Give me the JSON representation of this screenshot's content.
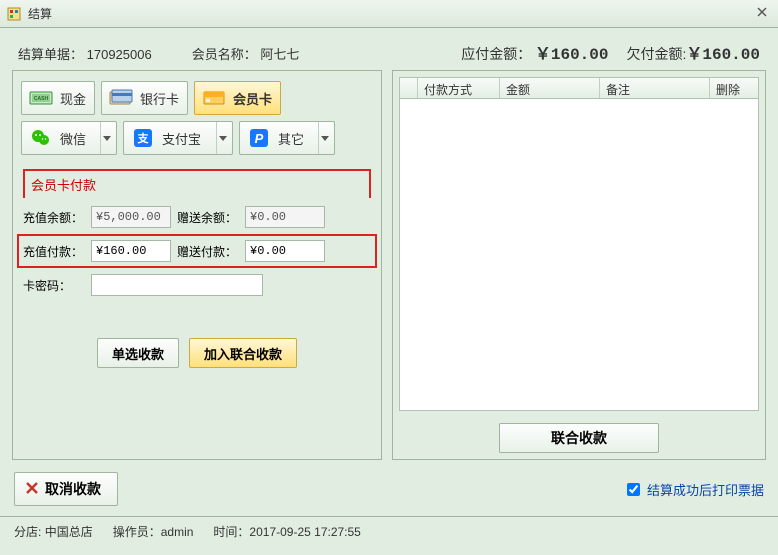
{
  "window": {
    "title": "结算"
  },
  "info": {
    "order_label": "结算单据：",
    "order_no": "170925006",
    "member_label": "会员名称：",
    "member_name": "阿七七",
    "due_label": "应付金额：",
    "due_value": "￥160.00",
    "owed_label": "欠付金额:",
    "owed_value": "￥160.00"
  },
  "pay_methods": {
    "cash": "现金",
    "bank": "银行卡",
    "member": "会员卡",
    "wechat": "微信",
    "alipay": "支付宝",
    "other": "其它"
  },
  "section": {
    "title": "会员卡付款",
    "recharge_balance_label": "充值余额：",
    "recharge_balance": "¥5,000.00",
    "gift_balance_label": "赠送余额：",
    "gift_balance": "¥0.00",
    "recharge_pay_label": "充值付款：",
    "recharge_pay": "¥160.00",
    "gift_pay_label": "赠送付款：",
    "gift_pay": "¥0.00",
    "card_pwd_label": "卡密码："
  },
  "buttons": {
    "single": "单选收款",
    "join": "加入联合收款",
    "combine": "联合收款",
    "cancel": "取消收款"
  },
  "grid": {
    "col_method": "付款方式",
    "col_amount": "金额",
    "col_remark": "备注",
    "col_delete": "删除"
  },
  "checkbox": {
    "print_label": "结算成功后打印票据"
  },
  "status": {
    "branch_label": "分店:",
    "branch": "中国总店",
    "op_label": "操作员：",
    "op": "admin",
    "time_label": "时间：",
    "time": "2017-09-25 17:27:55"
  }
}
